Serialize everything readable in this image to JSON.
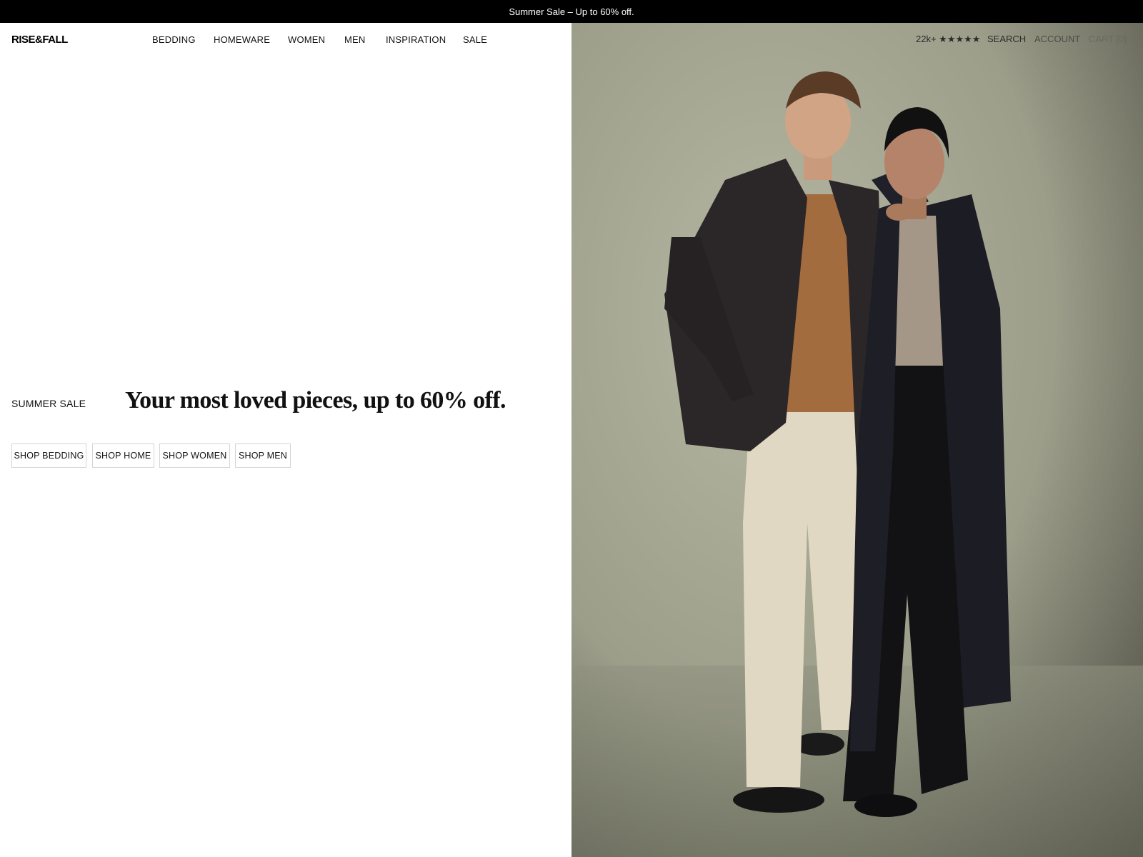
{
  "announcement": {
    "text": "Summer Sale – Up to 60% off."
  },
  "header": {
    "logo": "RISE&FALL",
    "nav": [
      "BEDDING",
      "HOMEWARE",
      "WOMEN",
      "MEN",
      "INSPIRATION",
      "SALE"
    ],
    "reviews": "22k+ ★★★★★",
    "search": "SEARCH",
    "account": "ACCOUNT",
    "cart": "CART [0]"
  },
  "hero": {
    "eyebrow": "SUMMER SALE",
    "headline": "Your most loved pieces, up to 60% off.",
    "buttons": [
      "SHOP BEDDING",
      "SHOP HOME",
      "SHOP WOMEN",
      "SHOP MEN"
    ]
  },
  "colors": {
    "announcement_bg": "#000000",
    "backdrop": "#a3a48f",
    "jacket": "#2b2627",
    "sweater": "#a26c3e",
    "trousers": "#e1d8c3",
    "coat": "#1c1c24"
  }
}
